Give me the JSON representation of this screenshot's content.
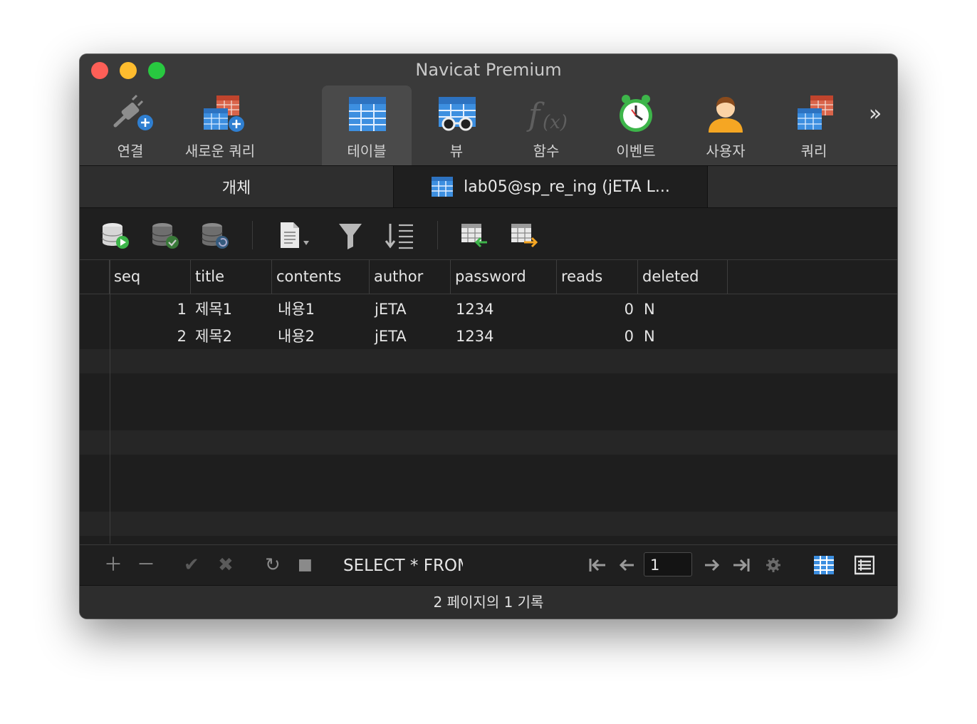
{
  "window": {
    "title": "Navicat Premium"
  },
  "toolbar": {
    "items": [
      {
        "label": "연결"
      },
      {
        "label": "새로운 쿼리"
      },
      {
        "label": "테이블"
      },
      {
        "label": "뷰"
      },
      {
        "label": "함수"
      },
      {
        "label": "이벤트"
      },
      {
        "label": "사용자"
      },
      {
        "label": "쿼리"
      }
    ],
    "more": "»",
    "active": "테이블"
  },
  "tabs": {
    "objects": "개체",
    "table": "lab05@sp_re_ing (jETA L..."
  },
  "grid": {
    "columns": [
      "seq",
      "title",
      "contents",
      "author",
      "password",
      "reads",
      "deleted"
    ],
    "rows": [
      {
        "seq": "1",
        "title": "제목1",
        "contents": "내용1",
        "author": "jETA",
        "password": "1234",
        "reads": "0",
        "deleted": "N"
      },
      {
        "seq": "2",
        "title": "제목2",
        "contents": "내용2",
        "author": "jETA",
        "password": "1234",
        "reads": "0",
        "deleted": "N"
      }
    ]
  },
  "bottom": {
    "sql": "SELECT * FROM",
    "page": "1"
  },
  "status": "2 페이지의 1 기록",
  "colors": {
    "accent_blue": "#3d8fe0",
    "window_bg": "#1e1e1e",
    "toolbar_bg": "#3a3a3a"
  }
}
